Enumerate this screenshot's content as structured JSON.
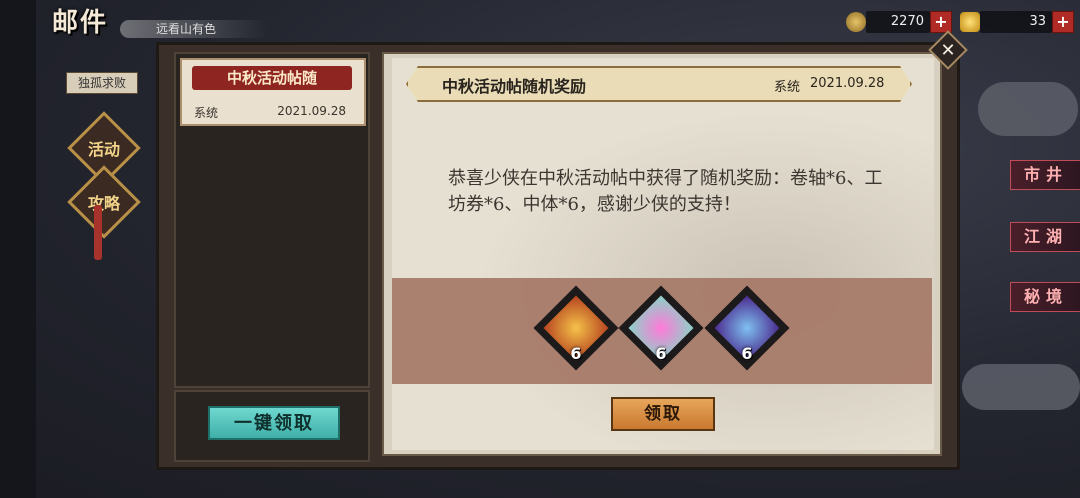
{
  "header": {
    "title": "邮件",
    "subtitle": "远看山有色",
    "player_name": "独孤求败"
  },
  "side_ornaments": [
    {
      "label": "活动",
      "icon": "lantern-ornament-icon"
    },
    {
      "label": "攻略",
      "icon": "lantern-ornament-icon"
    }
  ],
  "currency": [
    {
      "icon": "coin-icon",
      "value": "2270"
    },
    {
      "icon": "gold-ingot-icon",
      "value": "33"
    }
  ],
  "right_menu": [
    {
      "label": "市井"
    },
    {
      "label": "江湖"
    },
    {
      "label": "秘境"
    }
  ],
  "mail_list": {
    "items": [
      {
        "title": "中秋活动帖随",
        "sender": "系统",
        "date": "2021.09.28",
        "selected": true
      }
    ],
    "claim_all_label": "一键领取"
  },
  "detail": {
    "title": "中秋活动帖随机奖励",
    "sender": "系统",
    "date": "2021.09.28",
    "body": "恭喜少侠在中秋活动帖中获得了随机奖励：卷轴*6、工坊券*6、中体*6，感谢少侠的支持！",
    "rewards": [
      {
        "icon": "scroll-reward-icon",
        "count": "6",
        "color": "#e8a21e"
      },
      {
        "icon": "workshop-ticket-reward-icon",
        "count": "6",
        "color": "#f0d56a"
      },
      {
        "icon": "physique-reward-icon",
        "count": "6",
        "color": "#6a3fb0"
      }
    ],
    "claim_label": "领取"
  },
  "colors": {
    "accent_red": "#8e2520",
    "claim_all": "#3fb0a8",
    "claim": "#c9792f"
  }
}
